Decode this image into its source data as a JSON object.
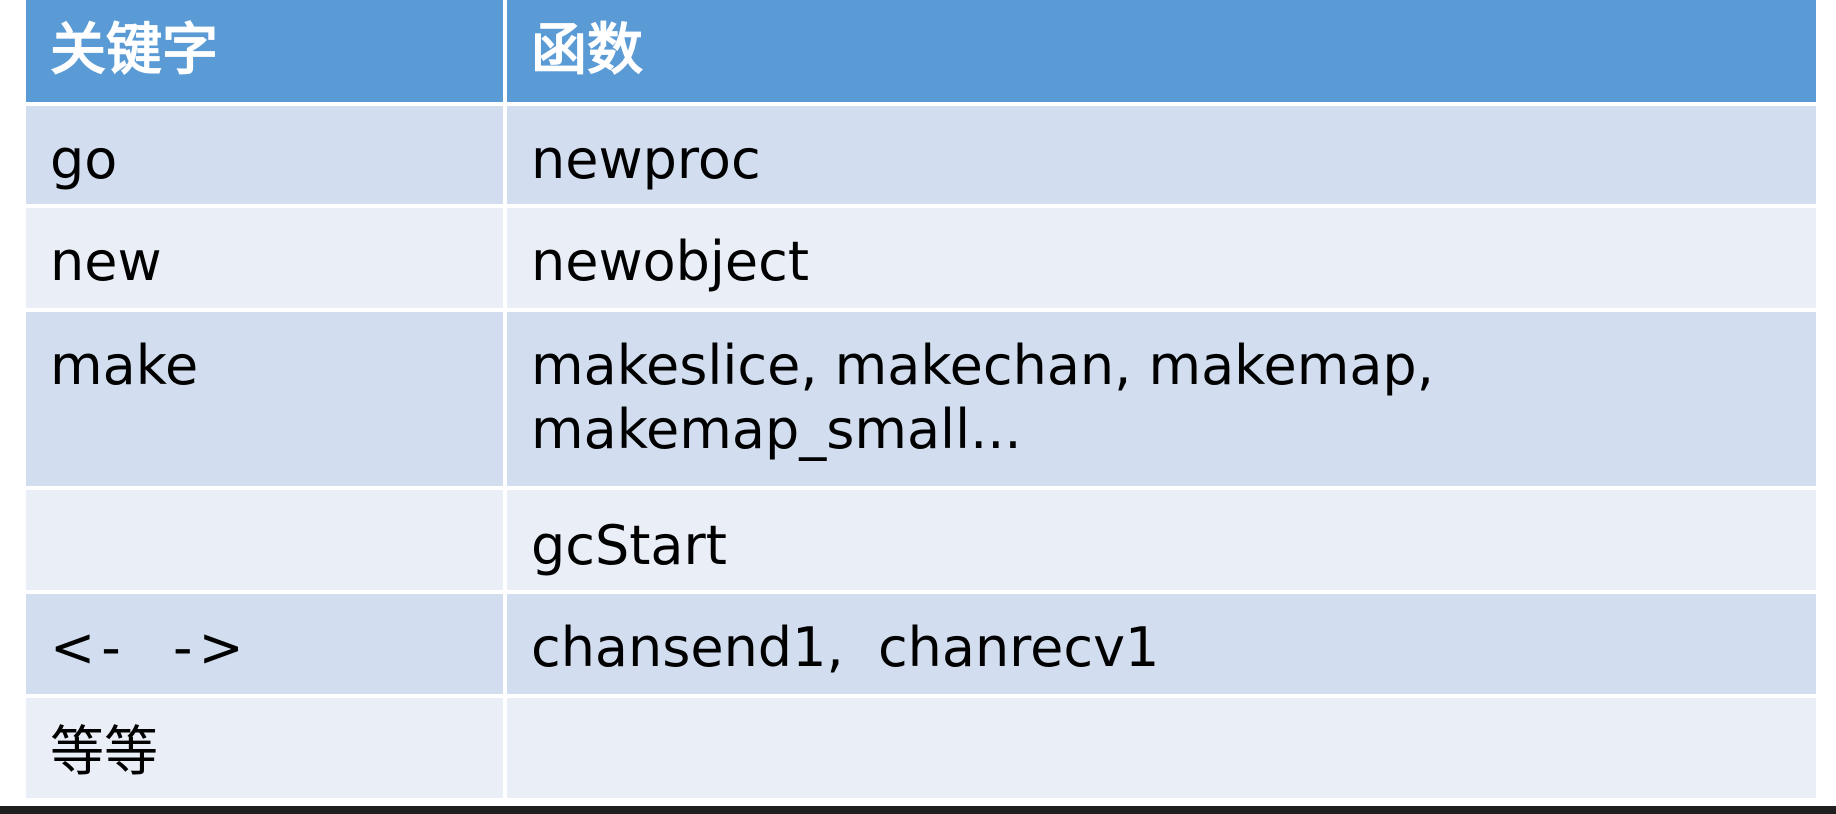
{
  "table": {
    "headers": [
      "关键字",
      "函数"
    ],
    "rows": [
      {
        "keyword": "go",
        "functions": "newproc"
      },
      {
        "keyword": "new",
        "functions": "newobject"
      },
      {
        "keyword": "make",
        "functions": "makeslice, makechan, makemap, makemap_small..."
      },
      {
        "keyword": "",
        "functions": "gcStart"
      },
      {
        "keyword": "<-  ->",
        "functions": "chansend1,  chanrecv1"
      },
      {
        "keyword": "等等",
        "functions": ""
      }
    ]
  },
  "colors": {
    "header_bg": "#5b9bd5",
    "row_dark": "#d2deef",
    "row_light": "#eaeff7"
  }
}
